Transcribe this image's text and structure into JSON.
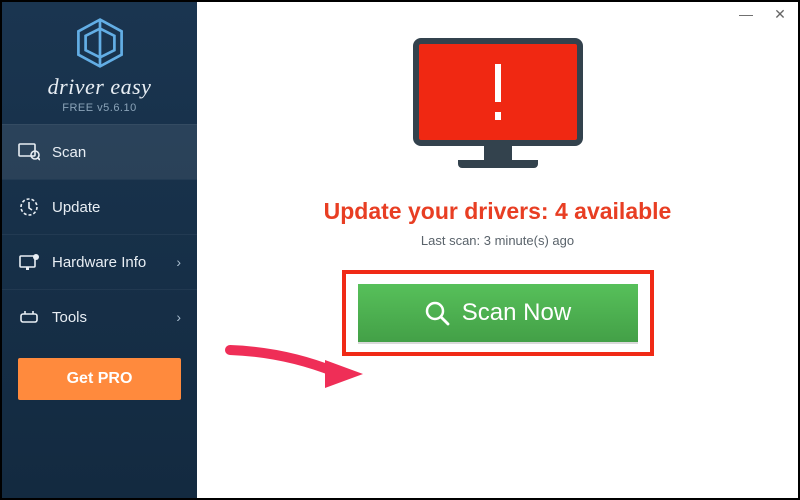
{
  "titlebar": {},
  "brand": {
    "name": "driver easy",
    "version": "FREE v5.6.10"
  },
  "sidebar": {
    "items": [
      {
        "label": "Scan",
        "has_submenu": false,
        "active": true
      },
      {
        "label": "Update",
        "has_submenu": false,
        "active": false
      },
      {
        "label": "Hardware Info",
        "has_submenu": true,
        "active": false
      },
      {
        "label": "Tools",
        "has_submenu": true,
        "active": false
      }
    ],
    "getpro_label": "Get PRO"
  },
  "main": {
    "headline": "Update your drivers: 4 available",
    "subline": "Last scan: 3 minute(s) ago",
    "scan_button_label": "Scan Now"
  }
}
